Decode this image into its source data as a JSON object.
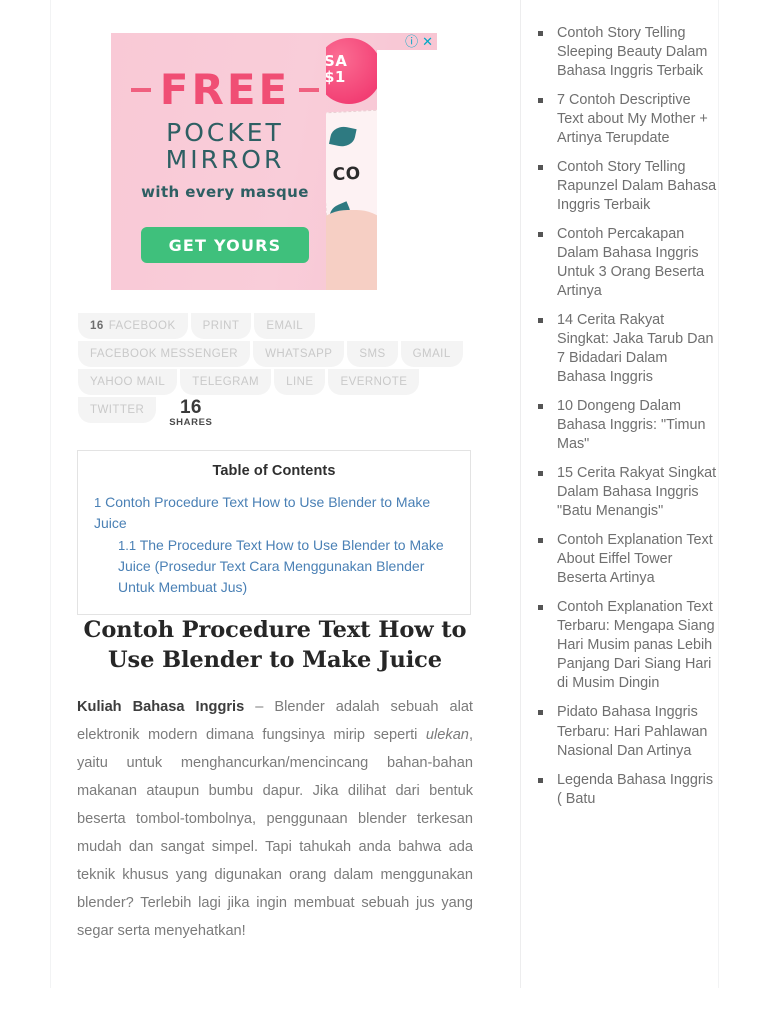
{
  "advertisement": {
    "info_icon": "info-icon",
    "close_icon": "close-icon",
    "dash": "—",
    "headline": "FREE",
    "line2": "POCKET",
    "line3": "MIRROR",
    "line4": "with every masque",
    "cta_label": "GET YOURS",
    "badge_line1": "SA",
    "badge_line2": "$1",
    "card_text": "CO"
  },
  "share": {
    "rows": [
      [
        {
          "count": "16",
          "label": "FACEBOOK",
          "name": "share-facebook"
        },
        {
          "count": "",
          "label": "PRINT",
          "name": "share-print"
        },
        {
          "count": "",
          "label": "EMAIL",
          "name": "share-email"
        }
      ],
      [
        {
          "count": "",
          "label": "FACEBOOK MESSENGER",
          "name": "share-facebook-messenger"
        },
        {
          "count": "",
          "label": "WHATSAPP",
          "name": "share-whatsapp"
        },
        {
          "count": "",
          "label": "SMS",
          "name": "share-sms"
        },
        {
          "count": "",
          "label": "GMAIL",
          "name": "share-gmail"
        }
      ],
      [
        {
          "count": "",
          "label": "YAHOO MAIL",
          "name": "share-yahoo-mail"
        },
        {
          "count": "",
          "label": "TELEGRAM",
          "name": "share-telegram"
        },
        {
          "count": "",
          "label": "LINE",
          "name": "share-line"
        },
        {
          "count": "",
          "label": "EVERNOTE",
          "name": "share-evernote"
        }
      ],
      [
        {
          "count": "",
          "label": "TWITTER",
          "name": "share-twitter"
        }
      ]
    ],
    "total_count": "16",
    "total_label": "SHARES"
  },
  "toc": {
    "title": "Table of Contents",
    "items": [
      {
        "num": "1",
        "text": "Contoh Procedure Text How to Use Blender to Make Juice",
        "level": 1
      },
      {
        "num": "1.1",
        "text": "The Procedure Text How to Use Blender to Make Juice (Prosedur Text Cara Menggunakan Blender Untuk Membuat Jus)",
        "level": 2
      }
    ]
  },
  "article": {
    "title": "Contoh Procedure Text How to Use Blender to Make Juice",
    "lead_bold": "Kuliah Bahasa Inggris",
    "body_part1": " – Blender adalah sebuah alat elektronik modern dimana fungsinya mirip seperti ",
    "body_italic": "ulekan",
    "body_part2": ", yaitu untuk menghancurkan/mencincang bahan-bahan makanan ataupun bumbu dapur. Jika dilihat dari bentuk beserta tombol-tombolnya, penggunaan blender terkesan mudah dan sangat simpel. Tapi tahukah anda bahwa ada teknik khusus yang digunakan orang dalam menggunakan blender? Terlebih lagi jika ingin membuat sebuah jus yang segar serta menyehatkan!"
  },
  "sidebar": {
    "items": [
      {
        "text": "Contoh Story Telling Sleeping Beauty Dalam Bahasa Inggris Terbaik"
      },
      {
        "text": "7 Contoh Descriptive Text about My Mother + Artinya Terupdate"
      },
      {
        "text": "Contoh Story Telling Rapunzel Dalam Bahasa Inggris Terbaik"
      },
      {
        "text": "Contoh Percakapan Dalam Bahasa Inggris Untuk 3 Orang Beserta Artinya"
      },
      {
        "text": "14 Cerita Rakyat Singkat: Jaka Tarub Dan 7 Bidadari Dalam Bahasa Inggris"
      },
      {
        "text": "10 Dongeng Dalam Bahasa Inggris: \"Timun Mas\""
      },
      {
        "text": "15 Cerita Rakyat Singkat Dalam Bahasa Inggris \"Batu Menangis\""
      },
      {
        "text": "Contoh Explanation Text About Eiffel Tower Beserta Artinya"
      },
      {
        "text": "Contoh Explanation Text Terbaru: Mengapa Siang Hari Musim panas Lebih Panjang Dari Siang Hari di Musim Dingin"
      },
      {
        "text": "Pidato Bahasa Inggris Terbaru: Hari Pahlawan Nasional Dan Artinya"
      },
      {
        "text": "Legenda Bahasa Inggris ( Batu"
      }
    ]
  },
  "colors": {
    "ad_pink": "#f9ccd7",
    "ad_free_pink": "#f04e74",
    "ad_teal": "#2e5f63",
    "ad_cta_green": "#3fc07c",
    "ad_icon_cyan": "#00a8c6",
    "toc_link_blue": "#4a80b5",
    "body_text": "#7b7b7b",
    "sidebar_text": "#6f6f6f"
  }
}
